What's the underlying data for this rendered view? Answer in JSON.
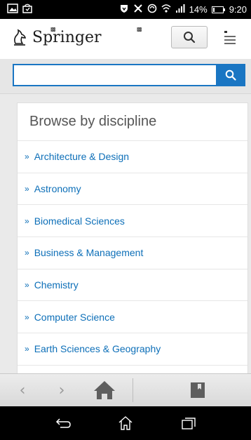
{
  "status_bar": {
    "battery_percent": "14%",
    "time": "9:20"
  },
  "header": {
    "logo_text": "Springer"
  },
  "search": {
    "value": "",
    "placeholder": ""
  },
  "browse": {
    "title": "Browse by discipline",
    "items": [
      {
        "label": "Architecture & Design"
      },
      {
        "label": "Astronomy"
      },
      {
        "label": "Biomedical Sciences"
      },
      {
        "label": "Business & Management"
      },
      {
        "label": "Chemistry"
      },
      {
        "label": "Computer Science"
      },
      {
        "label": "Earth Sciences & Geography"
      }
    ]
  },
  "colors": {
    "accent": "#1a76c3",
    "link": "#0d6fb8"
  },
  "icons": {
    "status_left": [
      "image-icon",
      "bag-icon"
    ],
    "status_right": [
      "shield-icon",
      "mute-icon",
      "sync-icon",
      "wifi-icon",
      "signal-icon",
      "battery-icon"
    ],
    "toolbar": [
      "back-arrow-icon",
      "forward-arrow-icon",
      "home-icon",
      "bookmark-icon"
    ],
    "nav": [
      "back-icon",
      "home-icon",
      "recents-icon"
    ]
  }
}
